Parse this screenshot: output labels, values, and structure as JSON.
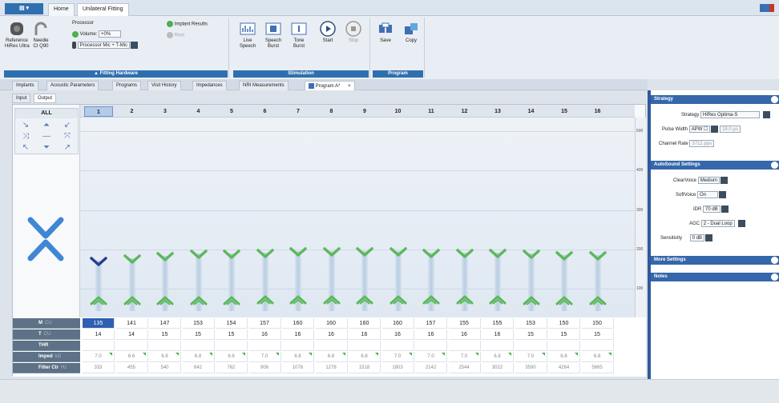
{
  "ribbon": {
    "tabs": [
      "Home",
      "Unilateral Fitting"
    ],
    "processor": {
      "title": "Processor",
      "volume_label": "Volume:",
      "volume_value": "+0%",
      "processor_value": "Processor Mic + T-Mic"
    },
    "reference_label": "Reference\nHiRes Ultra",
    "needle_label": "Needle\nCI Q90",
    "implant_results": "Implant Results",
    "rest_label": "Rest",
    "fitting_hardware": "Fitting Hardware",
    "stim_buttons": [
      {
        "label": "Live\nSpeech"
      },
      {
        "label": "Speech\nBurst"
      },
      {
        "label": "Tone\nBurst"
      },
      {
        "label": "Start"
      },
      {
        "label": "Stop"
      }
    ],
    "stimulation": "Stimulation",
    "prog_buttons": [
      {
        "label": "Save"
      },
      {
        "label": "Copy"
      }
    ],
    "program": "Program"
  },
  "doc_tabs": [
    "Implants",
    "Acoustic Parameters",
    "Programs",
    "Visit History",
    "Impedances",
    "NRI Measurements",
    "Program A*"
  ],
  "io_tabs": [
    "Input",
    "Output"
  ],
  "grid": {
    "all_label": "ALL",
    "channels": [
      "1",
      "2",
      "3",
      "4",
      "5",
      "6",
      "7",
      "8",
      "9",
      "10",
      "11",
      "12",
      "13",
      "14",
      "15",
      "16"
    ],
    "selected_channel": "1",
    "y_ticks": [
      "500",
      "400",
      "300",
      "200",
      "100"
    ],
    "row_labels": [
      {
        "name": "M",
        "unit": "CU"
      },
      {
        "name": "T",
        "unit": "CU"
      },
      {
        "name": "THR",
        "unit": ""
      },
      {
        "name": "Imped",
        "unit": "kΩ"
      },
      {
        "name": "Filter Ctr",
        "unit": "Hz"
      }
    ],
    "m_levels": [
      "135",
      "141",
      "147",
      "153",
      "154",
      "157",
      "160",
      "160",
      "160",
      "160",
      "157",
      "155",
      "155",
      "153",
      "150",
      "150"
    ],
    "t_levels": [
      "14",
      "14",
      "15",
      "15",
      "15",
      "16",
      "16",
      "16",
      "16",
      "16",
      "16",
      "16",
      "16",
      "15",
      "15",
      "15"
    ],
    "impedance": [
      "7.0",
      "6.6",
      "6.8",
      "6.8",
      "6.6",
      "7.0",
      "6.8",
      "6.8",
      "6.8",
      "7.0",
      "7.0",
      "7.0",
      "6.8",
      "7.0",
      "6.8",
      "6.8"
    ],
    "filter_ctr": [
      "333",
      "455",
      "540",
      "642",
      "762",
      "906",
      "1076",
      "1278",
      "1518",
      "1803",
      "2142",
      "2544",
      "3022",
      "3590",
      "4264",
      "5665"
    ]
  },
  "right_panel": {
    "strategy_title": "Strategy",
    "strategy_label": "Strategy",
    "strategy_value": "HiRes Optima-S",
    "pulse_label": "Pulse Width",
    "pulse_value": "APW ☐",
    "pulse_extra": "18.0 µs",
    "channel_rate_label": "Channel Rate",
    "channel_rate_value": "3712 pps",
    "autosound_title": "AutoSound Settings",
    "clearvoice_label": "ClearVoice",
    "clearvoice_value": "Medium",
    "softvoice_label": "SoftVoice",
    "softvoice_value": "On",
    "idr_label": "IDR",
    "idr_value": "70 dB",
    "agc_label": "AGC",
    "agc_value": "2 - Dual Loop",
    "sensitivity_label": "Sensitivity",
    "sensitivity_value": "0 dB",
    "more_title": "More Settings",
    "notes_title": "Notes"
  },
  "colors": {
    "accent": "#2f6fb0",
    "marker_green": "#5cb85c",
    "selected_marker": "#2b3d8f",
    "x_blue": "#3f87d4"
  }
}
